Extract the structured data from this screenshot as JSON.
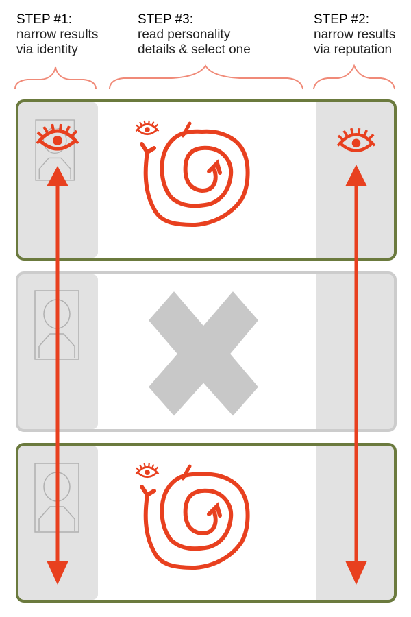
{
  "steps": [
    {
      "id": "step1",
      "title": "STEP #1:",
      "line1": "narrow results",
      "line2": "via identity"
    },
    {
      "id": "step3",
      "title": "STEP #3:",
      "line1": "read personality",
      "line2": "details & select one"
    },
    {
      "id": "step2",
      "title": "STEP #2:",
      "line1": "narrow results",
      "line2": "via reputation"
    }
  ],
  "cards": [
    {
      "state": "selected",
      "identity_marked": true,
      "reputation_marked": true,
      "content": "personality-spiral"
    },
    {
      "state": "rejected",
      "identity_marked": false,
      "reputation_marked": false,
      "content": "rejected-x"
    },
    {
      "state": "selected",
      "identity_marked": false,
      "reputation_marked": false,
      "content": "personality-spiral"
    }
  ],
  "colors": {
    "accent": "#e8401f",
    "selected_border": "#6b7a3e",
    "rejected_border": "#cccccc",
    "column_fill": "#e2e2e2",
    "x_fill": "#c8c8c8",
    "brace": "#f08a78"
  }
}
